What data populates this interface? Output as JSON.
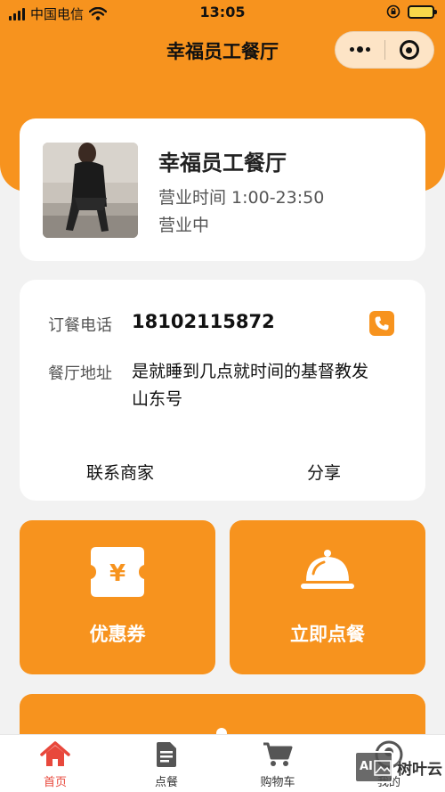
{
  "status_bar": {
    "carrier": "中国电信",
    "time": "13:05"
  },
  "nav": {
    "title": "幸福员工餐厅"
  },
  "shop": {
    "name": "幸福员工餐厅",
    "hours": "营业时间 1:00-23:50",
    "status": "营业中"
  },
  "info": {
    "phone_label": "订餐电话",
    "phone": "18102115872",
    "address_label": "餐厅地址",
    "address": "是就睡到几点就时间的基督教发山东号",
    "contact_label": "联系商家",
    "share_label": "分享"
  },
  "tiles": {
    "coupon_label": "优惠券",
    "order_label": "立即点餐",
    "coupon_symbol": "¥"
  },
  "tabbar": {
    "items": [
      {
        "label": "首页",
        "icon": "home-icon"
      },
      {
        "label": "点餐",
        "icon": "order-icon"
      },
      {
        "label": "购物车",
        "icon": "cart-icon"
      },
      {
        "label": "我的",
        "icon": "profile-icon"
      }
    ],
    "active": "首页",
    "active_color": "#e8483c"
  },
  "watermark": {
    "badge": "AI",
    "text": "树叶云"
  },
  "colors": {
    "accent": "#f7931e",
    "background": "#f2f2f2"
  }
}
